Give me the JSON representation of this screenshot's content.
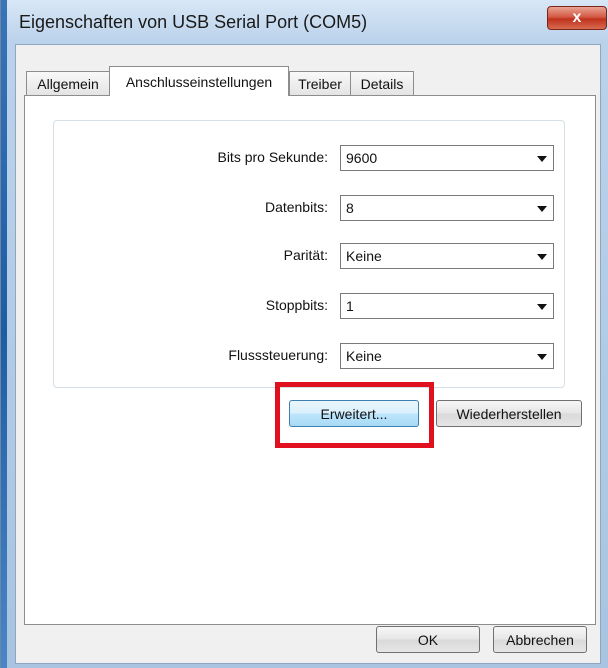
{
  "window": {
    "title": "Eigenschaften von USB Serial Port (COM5)",
    "close_label": "x"
  },
  "tabs": [
    {
      "label": "Allgemein",
      "active": false
    },
    {
      "label": "Anschlusseinstellungen",
      "active": true
    },
    {
      "label": "Treiber",
      "active": false
    },
    {
      "label": "Details",
      "active": false
    }
  ],
  "settings": {
    "bits_label": "Bits pro Sekunde:",
    "bits_value": "9600",
    "databits_label": "Datenbits:",
    "databits_value": "8",
    "parity_label": "Parität:",
    "parity_value": "Keine",
    "stopbits_label": "Stoppbits:",
    "stopbits_value": "1",
    "flow_label": "Flusssteuerung:",
    "flow_value": "Keine"
  },
  "buttons": {
    "advanced": "Erweitert...",
    "restore": "Wiederherstellen",
    "ok": "OK",
    "cancel": "Abbrechen"
  },
  "colors": {
    "highlight": "#e0101e",
    "close_button": "#c0321e"
  }
}
